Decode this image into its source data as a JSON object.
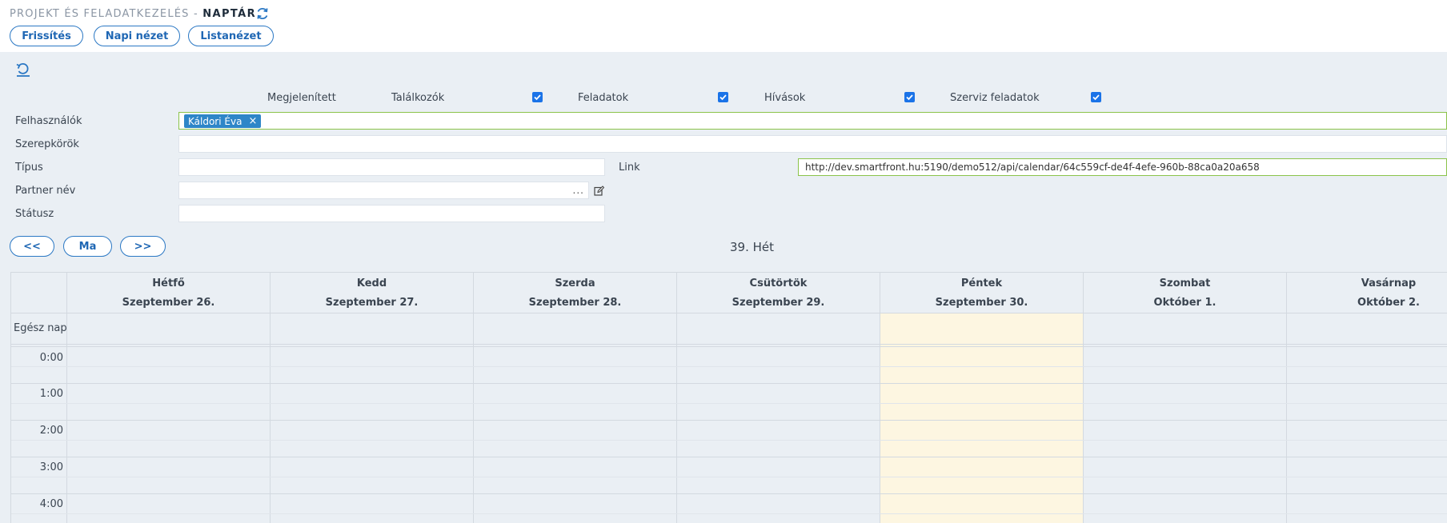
{
  "header": {
    "breadcrumb": "PROJEKT ÉS FELADATKEZELÉS -",
    "title": "NAPTÁR",
    "buttons": {
      "refresh": "Frissítés",
      "day_view": "Napi nézet",
      "list_view": "Listanézet"
    }
  },
  "filters": {
    "displayed_label": "Megjelenített",
    "toggles": [
      {
        "label": "Találkozók",
        "checked": true
      },
      {
        "label": "Feladatok",
        "checked": true
      },
      {
        "label": "Hívások",
        "checked": true
      },
      {
        "label": "Szerviz feladatok",
        "checked": true
      }
    ],
    "users_label": "Felhasználók",
    "users_chip": "Káldori Éva",
    "roles_label": "Szerepkörök",
    "type_label": "Típus",
    "link_label": "Link",
    "link_value": "http://dev.smartfront.hu:5190/demo512/api/calendar/64c559cf-de4f-4efe-960b-88ca0a20a658",
    "partner_label": "Partner név",
    "partner_dots": "...",
    "status_label": "Státusz"
  },
  "nav": {
    "prev": "<<",
    "today": "Ma",
    "next": ">>",
    "week_label": "39. Hét"
  },
  "calendar": {
    "all_day_label": "Egész nap",
    "days": [
      {
        "name": "Hétfő",
        "date": "Szeptember 26."
      },
      {
        "name": "Kedd",
        "date": "Szeptember 27."
      },
      {
        "name": "Szerda",
        "date": "Szeptember 28."
      },
      {
        "name": "Csütörtök",
        "date": "Szeptember 29."
      },
      {
        "name": "Péntek",
        "date": "Szeptember 30."
      },
      {
        "name": "Szombat",
        "date": "Október 1."
      },
      {
        "name": "Vasárnap",
        "date": "Október 2."
      }
    ],
    "hours": [
      "0:00",
      "1:00",
      "2:00",
      "3:00",
      "4:00"
    ],
    "today_index": 4
  },
  "colors": {
    "accent": "#1f67b4",
    "checkbox": "#1a73e8",
    "chip": "#2e86c8",
    "today": "#fdf6e1",
    "valid_border": "#8bc34a"
  }
}
